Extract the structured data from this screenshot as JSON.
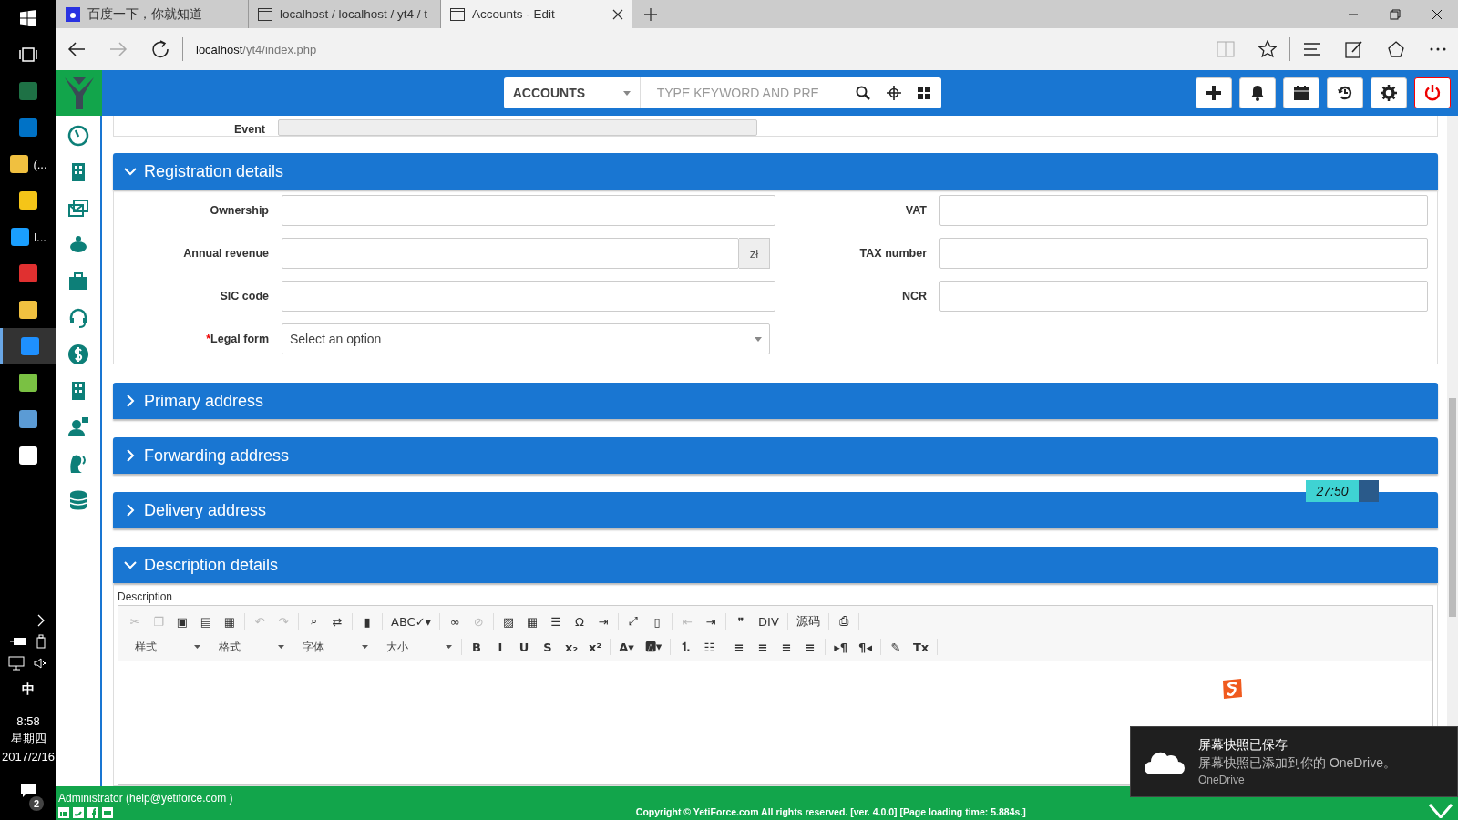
{
  "taskbar": {
    "items": [
      {
        "selected": false
      },
      {
        "selected": false
      },
      {
        "label": "(...",
        "selected": false
      },
      {
        "selected": false
      },
      {
        "label": "l...",
        "selected": false
      },
      {
        "selected": false
      },
      {
        "selected": false
      },
      {
        "selected": true
      },
      {
        "selected": false
      },
      {
        "selected": false
      },
      {
        "selected": false
      }
    ],
    "tray": {
      "ime": "中",
      "time": "8:58",
      "weekday": "星期四",
      "date": "2017/2/16",
      "notifications": "2"
    }
  },
  "browser": {
    "tabs": [
      {
        "title": "百度一下，你就知道",
        "selected": false
      },
      {
        "title": "localhost / localhost / yt4 / t",
        "selected": false
      },
      {
        "title": "Accounts - Edit",
        "selected": true
      }
    ],
    "address": {
      "host": "localhost",
      "path": "/yt4/index.php"
    }
  },
  "header": {
    "module": "ACCOUNTS",
    "search_placeholder": "TYPE KEYWORD AND PRE"
  },
  "form": {
    "top_label": "Event",
    "sections": [
      {
        "title": "Registration details",
        "expanded": true,
        "left": [
          {
            "label": "Ownership"
          },
          {
            "label": "Annual revenue",
            "addon": "zł"
          },
          {
            "label": "SIC code"
          },
          {
            "label": "Legal form",
            "required_mark": "*",
            "kind": "select",
            "placeholder": "Select an option"
          }
        ],
        "right": [
          {
            "label": "VAT"
          },
          {
            "label": "TAX number"
          },
          {
            "label": "NCR"
          }
        ]
      },
      {
        "title": "Primary address",
        "expanded": false
      },
      {
        "title": "Forwarding address",
        "expanded": false
      },
      {
        "title": "Delivery address",
        "expanded": false
      },
      {
        "title": "Description details",
        "expanded": true,
        "editor_label": "Description",
        "toolbar_row1": [
          [
            {
              "glyph": "✂",
              "disabled": true
            },
            {
              "glyph": "❐",
              "disabled": true
            },
            {
              "glyph": "▣",
              "disabled": false
            },
            {
              "glyph": "▤",
              "disabled": false
            },
            {
              "glyph": "▦",
              "disabled": false
            }
          ],
          [
            {
              "glyph": "↶",
              "disabled": true
            },
            {
              "glyph": "↷",
              "disabled": true
            }
          ],
          [
            {
              "glyph": "⌕",
              "disabled": false
            },
            {
              "glyph": "⇄",
              "disabled": false
            }
          ],
          [
            {
              "glyph": "▮",
              "disabled": false
            }
          ],
          [
            {
              "glyph": "ABC✓▾",
              "disabled": false
            }
          ],
          [
            {
              "glyph": "∞",
              "disabled": false
            },
            {
              "glyph": "⊘",
              "disabled": true
            }
          ],
          [
            {
              "glyph": "▨",
              "disabled": false
            },
            {
              "glyph": "▦",
              "disabled": false
            },
            {
              "glyph": "☰",
              "disabled": false
            },
            {
              "glyph": "Ω",
              "disabled": false
            },
            {
              "glyph": "⇥",
              "disabled": false
            }
          ],
          [
            {
              "glyph": "⤢",
              "disabled": false
            },
            {
              "glyph": "▯",
              "disabled": false
            }
          ],
          [
            {
              "glyph": "⇤",
              "disabled": true
            },
            {
              "glyph": "⇥",
              "disabled": false
            }
          ],
          [
            {
              "glyph": "❞",
              "disabled": false
            },
            {
              "glyph": "DIV",
              "disabled": false
            }
          ],
          [
            {
              "glyph": "源码",
              "disabled": false
            }
          ],
          [
            {
              "glyph": "⎙",
              "disabled": false
            }
          ]
        ],
        "dropdowns": [
          "样式",
          "格式",
          "字体",
          "大小"
        ],
        "toolbar_row2": [
          [
            {
              "glyph": "B",
              "disabled": false
            },
            {
              "glyph": "I",
              "disabled": false
            },
            {
              "glyph": "U",
              "disabled": false
            },
            {
              "glyph": "S",
              "disabled": false
            },
            {
              "glyph": "x₂",
              "disabled": false
            },
            {
              "glyph": "x²",
              "disabled": false
            }
          ],
          [
            {
              "glyph": "A▾",
              "disabled": false
            },
            {
              "glyph": "🅰▾",
              "disabled": false
            }
          ],
          [
            {
              "glyph": "⒈",
              "disabled": false
            },
            {
              "glyph": "☷",
              "disabled": false
            }
          ],
          [
            {
              "glyph": "≡",
              "disabled": false
            },
            {
              "glyph": "≡",
              "disabled": false
            },
            {
              "glyph": "≡",
              "disabled": false
            },
            {
              "glyph": "≡",
              "disabled": false
            }
          ],
          [
            {
              "glyph": "▸¶",
              "disabled": false
            },
            {
              "glyph": "¶◂",
              "disabled": false
            }
          ],
          [
            {
              "glyph": "✎",
              "disabled": false
            },
            {
              "glyph": "Tx",
              "disabled": false
            }
          ]
        ]
      }
    ]
  },
  "timer": "27:50",
  "toast": {
    "title": "屏幕快照已保存",
    "body": "屏幕快照已添加到你的 OneDrive。",
    "source": "OneDrive"
  },
  "footer": {
    "user": "Administrator  (help@yetiforce.com )",
    "copyright": "Copyright © YetiForce.com All rights reserved. [ver. 4.0.0] [Page loading time: 5.884s.]"
  }
}
